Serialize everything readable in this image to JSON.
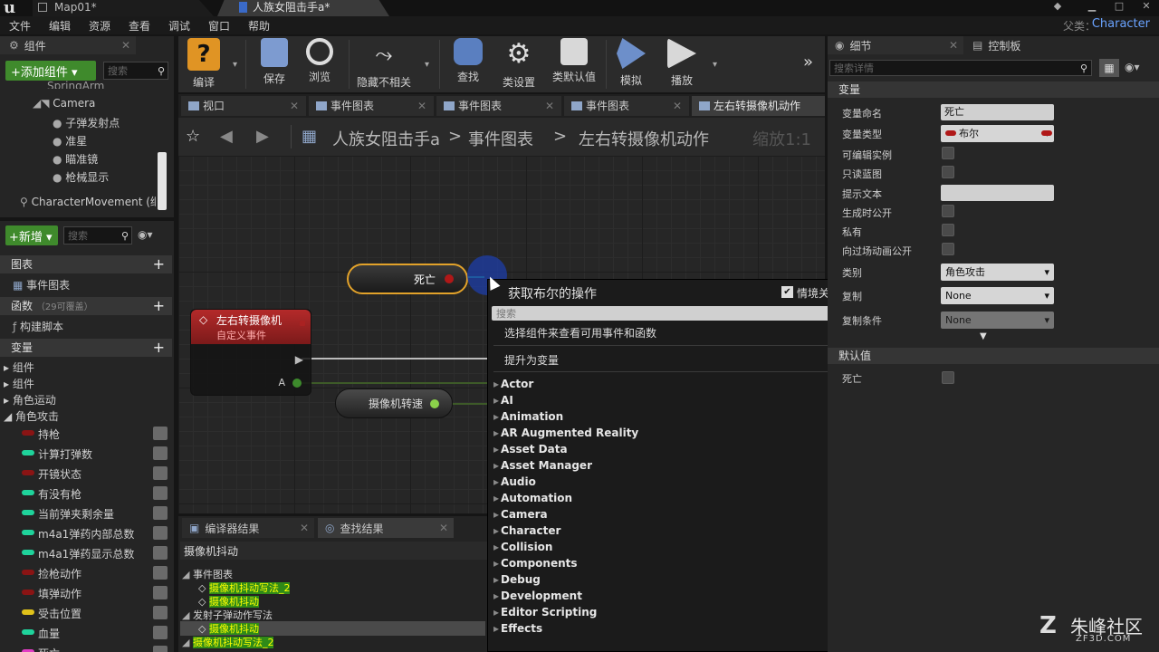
{
  "title_bar": {
    "tabs": [
      "Map01*",
      "人族女阻击手a*"
    ]
  },
  "menu": {
    "items": [
      "文件",
      "编辑",
      "资源",
      "查看",
      "调试",
      "窗口",
      "帮助"
    ],
    "parent_label": "父类：",
    "parent_value": "Character"
  },
  "components_panel": {
    "tab": "组件",
    "add_button": "+添加组件 ▾",
    "search_placeholder": "搜索",
    "tree": [
      "SpringArm",
      "Camera",
      "子弹发射点",
      "准星",
      "瞄准镜",
      "枪械显示",
      "CharacterMovement (继"
    ]
  },
  "my_blueprint": {
    "new_button": "+新增 ▾",
    "search_placeholder": "搜索",
    "sections": {
      "graphs": "图表",
      "event_graph": "事件图表",
      "functions": "函数",
      "functions_hint": "（29可覆盖）",
      "construct_script": "构建脚本",
      "variables": "变量"
    },
    "var_categories": [
      "组件",
      "组件",
      "角色运动",
      "角色攻击"
    ],
    "variables": [
      {
        "name": "持枪",
        "color": "#8a1414"
      },
      {
        "name": "计算打弹数",
        "color": "#1fd39b"
      },
      {
        "name": "开镜状态",
        "color": "#8a1414"
      },
      {
        "name": "有没有枪",
        "color": "#1fd39b"
      },
      {
        "name": "当前弹夹剩余量",
        "color": "#1fd39b"
      },
      {
        "name": "m4a1弹药内部总数",
        "color": "#1fd39b"
      },
      {
        "name": "m4a1弹药显示总数",
        "color": "#1fd39b"
      },
      {
        "name": "捡枪动作",
        "color": "#8a1414"
      },
      {
        "name": "填弹动作",
        "color": "#8a1414"
      },
      {
        "name": "受击位置",
        "color": "#e0c21a"
      },
      {
        "name": "血量",
        "color": "#1fd39b"
      },
      {
        "name": "死亡",
        "color": "#e23cc4"
      }
    ]
  },
  "toolbar": {
    "items": [
      "编译",
      "保存",
      "浏览",
      "隐藏不相关",
      "查找",
      "类设置",
      "类默认值",
      "模拟",
      "播放"
    ]
  },
  "graph_tabs": [
    "视口",
    "事件图表",
    "事件图表",
    "事件图表",
    "左右转摄像机动作"
  ],
  "breadcrumb": {
    "blueprint": "人族女阻击手a",
    "graph": "事件图表",
    "function": "左右转摄像机动作",
    "zoom": "缩放1:1"
  },
  "graph": {
    "event_node": {
      "title": "左右转摄像机",
      "subtitle": "自定义事件",
      "pin_a": "A"
    },
    "var_node_dead": "死亡",
    "var_node_camera_speed": "摄像机转速"
  },
  "context_menu": {
    "title": "获取布尔的操作",
    "context_sensitive": "情境关联",
    "search_placeholder": "搜索",
    "hint": "选择组件来查看可用事件和函数",
    "promote": "提升为变量",
    "categories": [
      "Actor",
      "AI",
      "Animation",
      "AR Augmented Reality",
      "Asset Data",
      "Asset Manager",
      "Audio",
      "Automation",
      "Camera",
      "Character",
      "Collision",
      "Components",
      "Debug",
      "Development",
      "Editor Scripting",
      "Effects"
    ]
  },
  "details": {
    "tab_details": "细节",
    "tab_palette": "控制板",
    "search_placeholder": "搜索详情",
    "section_variable": "变量",
    "rows": [
      {
        "label": "变量命名",
        "value": "死亡"
      },
      {
        "label": "变量类型",
        "value": "布尔"
      },
      {
        "label": "可编辑实例"
      },
      {
        "label": "只读蓝图"
      },
      {
        "label": "提示文本"
      },
      {
        "label": "生成时公开"
      },
      {
        "label": "私有"
      },
      {
        "label": "向过场动画公开"
      },
      {
        "label": "类别",
        "value": "角色攻击"
      },
      {
        "label": "复制",
        "value": "None"
      },
      {
        "label": "复制条件",
        "value": "None"
      }
    ],
    "section_default": "默认值",
    "default_label": "死亡"
  },
  "results": {
    "tab_compiler": "编译器结果",
    "tab_find": "查找结果",
    "query": "摄像机抖动",
    "lines": [
      {
        "text": "事件图表",
        "indent": 0
      },
      {
        "text": "摄像机抖动写法_2",
        "indent": 1
      },
      {
        "text": "摄像机抖动",
        "indent": 1
      },
      {
        "text": "发射子弹动作写法",
        "indent": 0
      },
      {
        "text": "摄像机抖动",
        "indent": 1
      },
      {
        "text": "摄像机抖动写法_2",
        "indent": 0
      }
    ]
  },
  "watermark": {
    "brand": "朱峰社区",
    "site": "ZF3D.COM"
  }
}
